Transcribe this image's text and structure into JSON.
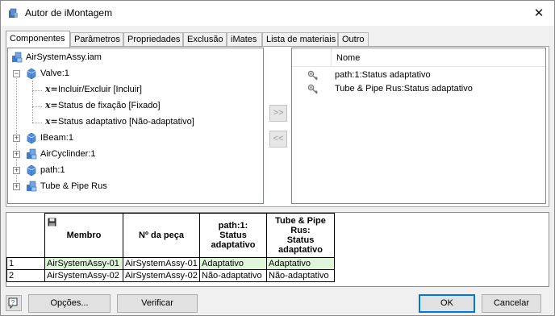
{
  "window": {
    "title": "Autor de iMontagem",
    "close_glyph": "✕"
  },
  "tabs": [
    {
      "label": "Componentes",
      "active": true
    },
    {
      "label": "Parâmetros",
      "active": false
    },
    {
      "label": "Propriedades",
      "active": false
    },
    {
      "label": "Exclusão",
      "active": false
    },
    {
      "label": "iMates",
      "active": false
    },
    {
      "label": "Lista de materiais",
      "active": false
    },
    {
      "label": "Outro",
      "active": false
    }
  ],
  "tree": {
    "root": "AirSystemAssy.iam",
    "valve": "Valve:1",
    "valve_children": [
      "Incluir/Excluir [Incluir]",
      "Status de fixação [Fixado]",
      "Status adaptativo [Não-adaptativo]"
    ],
    "x_glyph": "x=",
    "items": [
      "IBeam:1",
      "AirCyclinder:1",
      "path:1",
      "Tube & Pipe Rus"
    ],
    "expand_glyph": "+",
    "collapse_glyph": "−"
  },
  "middle": {
    "add": ">>",
    "remove": "<<"
  },
  "list": {
    "header": "Nome",
    "rows": [
      "path:1:Status adaptativo",
      "Tube & Pipe Rus:Status adaptativo"
    ]
  },
  "grid": {
    "headers": [
      "Membro",
      "Nº da peça",
      "path:1:\nStatus\nadaptativo",
      "Tube & Pipe\nRus:\nStatus\nadaptativo"
    ],
    "rows": [
      {
        "num": "1",
        "cells": [
          "AirSystemAssy-01",
          "AirSystemAssy-01",
          "Adaptativo",
          "Adaptativo"
        ]
      },
      {
        "num": "2",
        "cells": [
          "AirSystemAssy-02",
          "AirSystemAssy-02",
          "Não-adaptativo",
          "Não-adaptativo"
        ]
      }
    ],
    "highlight_color": "#dff5d9"
  },
  "footer": {
    "help": "?",
    "options": "Opções...",
    "verify": "Verificar",
    "ok": "OK",
    "cancel": "Cancelar"
  }
}
